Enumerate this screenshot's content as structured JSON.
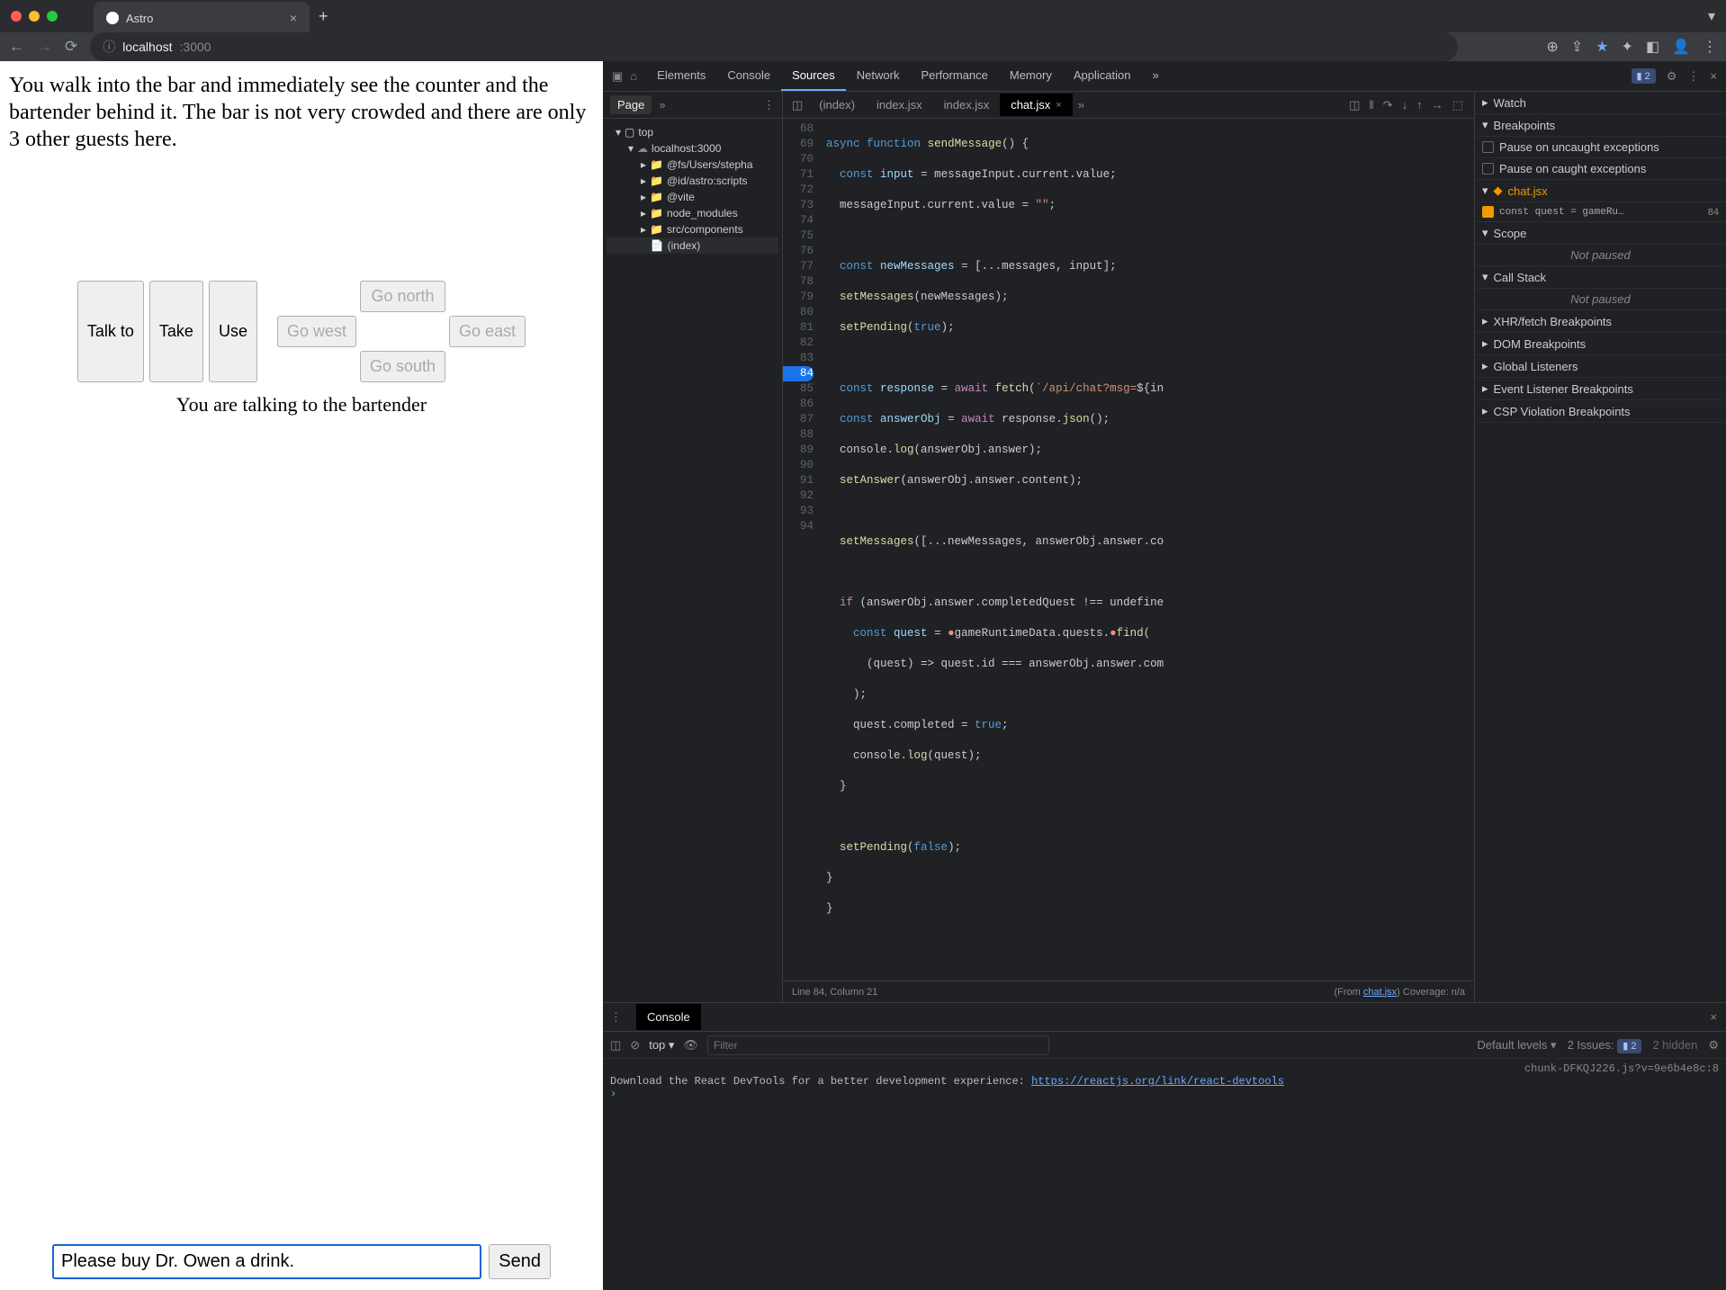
{
  "browser": {
    "tab_title": "Astro",
    "url_host": "localhost",
    "url_path": ":3000"
  },
  "page": {
    "description": "You walk into the bar and immediately see the counter and the bartender behind it. The bar is not very crowded and there are only 3 other guests here.",
    "buttons": {
      "talk_to": "Talk to",
      "take": "Take",
      "use": "Use",
      "go_north": "Go north",
      "go_west": "Go west",
      "go_east": "Go east",
      "go_south": "Go south"
    },
    "status": "You are talking to the bartender",
    "chat_value": "Please buy Dr. Owen a drink.",
    "send": "Send"
  },
  "devtools": {
    "tabs": [
      "Elements",
      "Console",
      "Sources",
      "Network",
      "Performance",
      "Memory",
      "Application"
    ],
    "active_tab": "Sources",
    "issues_count": "2",
    "files_header": "Page",
    "tree": {
      "top": "top",
      "host": "localhost:3000",
      "f1": "@fs/Users/stepha",
      "f2": "@id/astro:scripts",
      "f3": "@vite",
      "f4": "node_modules",
      "f5": "src/components",
      "file": "(index)"
    },
    "editor_tabs": [
      "(index)",
      "index.jsx",
      "index.jsx",
      "chat.jsx"
    ],
    "cursor": "Line 84, Column 21",
    "coverage_from": "(From ",
    "coverage_file": "chat.jsx",
    "coverage_after": ") Coverage: n/a",
    "right": {
      "watch": "Watch",
      "breakpoints": "Breakpoints",
      "pause_uncaught": "Pause on uncaught exceptions",
      "pause_caught": "Pause on caught exceptions",
      "bp_file": "chat.jsx",
      "bp_code": "const quest = gameRu…",
      "bp_line": "84",
      "scope": "Scope",
      "not_paused": "Not paused",
      "callstack": "Call Stack",
      "xhr": "XHR/fetch Breakpoints",
      "dom": "DOM Breakpoints",
      "global": "Global Listeners",
      "event": "Event Listener Breakpoints",
      "csp": "CSP Violation Breakpoints"
    }
  },
  "console": {
    "title": "Console",
    "context": "top",
    "filter_ph": "Filter",
    "levels": "Default levels",
    "issues_label": "2 Issues:",
    "issues_count": "2",
    "hidden": "2 hidden",
    "src": "chunk-DFKQJ226.js?v=9e6b4e8c:8",
    "msg": "Download the React DevTools for a better development experience: ",
    "link": "https://reactjs.org/link/react-devtools"
  }
}
